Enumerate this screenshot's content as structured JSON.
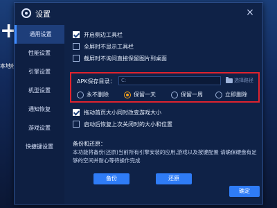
{
  "background": {
    "plus_glyph": "+",
    "side_text": "本地帐"
  },
  "dialog": {
    "title": "设置",
    "title_icon": "gear-icon",
    "close_glyph": "×"
  },
  "sidebar": {
    "items": [
      {
        "label": "通用设置",
        "active": true
      },
      {
        "label": "性能设置",
        "active": false
      },
      {
        "label": "引擎设置",
        "active": false
      },
      {
        "label": "机型设置",
        "active": false
      },
      {
        "label": "通知恢复",
        "active": false
      },
      {
        "label": "游戏设置",
        "active": false
      },
      {
        "label": "快捷键设置",
        "active": false
      }
    ]
  },
  "general": {
    "options_top": [
      {
        "label": "开启侧边工具栏",
        "checked": true
      },
      {
        "label": "全屏时不显示工具栏",
        "checked": false
      },
      {
        "label": "截屏时不询问直接保留图片到桌面",
        "checked": false
      }
    ],
    "apk": {
      "label": "APK保存目录：",
      "path_value": "C:",
      "choose_path": "选择路径",
      "radio_options": [
        {
          "label": "永不删除",
          "selected": false
        },
        {
          "label": "保留一天",
          "selected": true
        },
        {
          "label": "保留一周",
          "selected": false
        },
        {
          "label": "立即删除",
          "selected": false
        }
      ]
    },
    "options_bottom": [
      {
        "label": "拖动首页大小同时改变游戏大小",
        "checked": true
      },
      {
        "label": "启动后恢复上次关闭时的大小和位置",
        "checked": false
      }
    ],
    "backup": {
      "title": "备份和还原：",
      "description": "本功能将备份(还原)当前所有引擎安装的应用,游戏以及按键配置 请确保硬盘有足够的空间并耐心等待操作完成",
      "backup_button": "备份",
      "restore_button": "还原"
    },
    "confirm_button": "确定"
  },
  "colors": {
    "accent": "#2f7cf6",
    "highlight_border": "#e0232e",
    "radio_selected": "#f6a21a"
  }
}
